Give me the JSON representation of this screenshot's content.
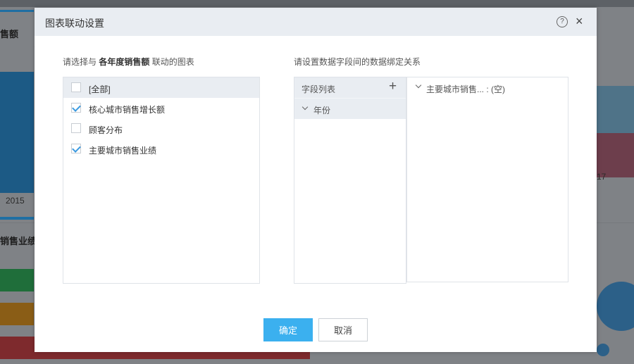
{
  "background": {
    "card1_title": "售额",
    "card1_tick": "2015",
    "card2_title": "销售业绩",
    "card3_tick": "17"
  },
  "dialog": {
    "title": "图表联动设置",
    "help_icon": "?",
    "close_icon": "×",
    "left_label_prefix": "请选择与",
    "left_label_target": "各年度销售额",
    "left_label_suffix": "联动的图表",
    "right_label": "请设置数据字段间的数据绑定关系",
    "chart_options": [
      {
        "label": "[全部]",
        "checked": false
      },
      {
        "label": "核心城市销售增长额",
        "checked": true
      },
      {
        "label": "顾客分布",
        "checked": false
      },
      {
        "label": "主要城市销售业绩",
        "checked": true
      }
    ],
    "field_list": {
      "header": "字段列表",
      "add_icon": "+",
      "items": [
        {
          "label": "年份"
        }
      ]
    },
    "binding": {
      "items": [
        {
          "label": "主要城市销售... : (空)"
        }
      ]
    },
    "ok_label": "确定",
    "cancel_label": "取消",
    "accent_color": "#3bb0ef",
    "check_color": "#3b9ae0"
  }
}
